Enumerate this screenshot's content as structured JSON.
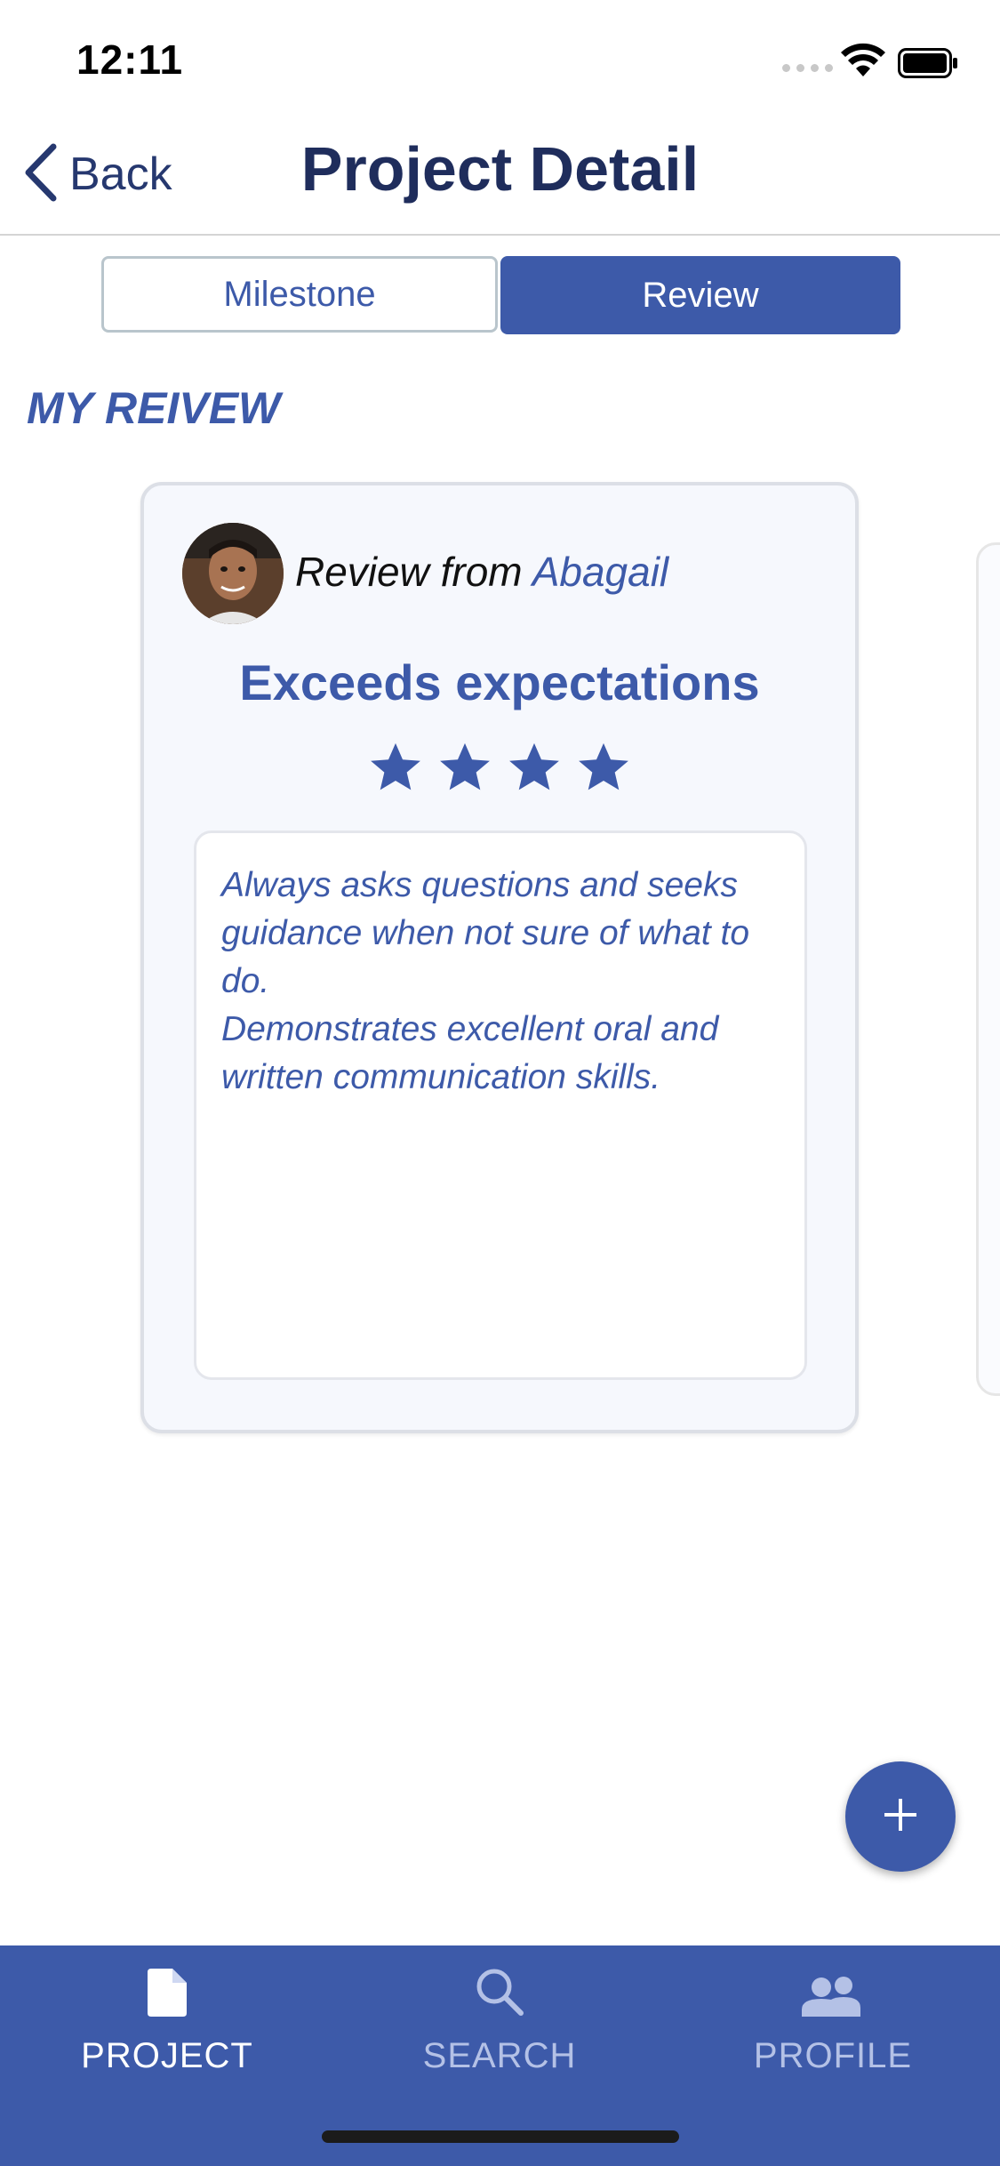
{
  "status_bar": {
    "time": "12:11"
  },
  "nav": {
    "back_label": "Back",
    "title": "Project Detail"
  },
  "segments": [
    {
      "label": "Milestone",
      "selected": false
    },
    {
      "label": "Review",
      "selected": true
    }
  ],
  "section_heading": "MY REIVEW",
  "review": {
    "from_prefix": "Review from ",
    "reviewer_name": "Abagail",
    "rating_title": "Exceeds expectations",
    "stars": 4,
    "text_lines": [
      "Always asks questions and seeks guidance when not sure of what to do.",
      "Demonstrates excellent oral and written communication skills."
    ]
  },
  "fab": {
    "icon": "plus-icon"
  },
  "tabbar": {
    "items": [
      {
        "label": "PROJECT",
        "icon": "document-icon",
        "active": true
      },
      {
        "label": "SEARCH",
        "icon": "search-icon",
        "active": false
      },
      {
        "label": "PROFILE",
        "icon": "people-icon",
        "active": false
      }
    ]
  },
  "colors": {
    "accent": "#3d5aa9",
    "nav_title": "#1f2d5c",
    "tab_inactive": "#b4c1e6"
  }
}
